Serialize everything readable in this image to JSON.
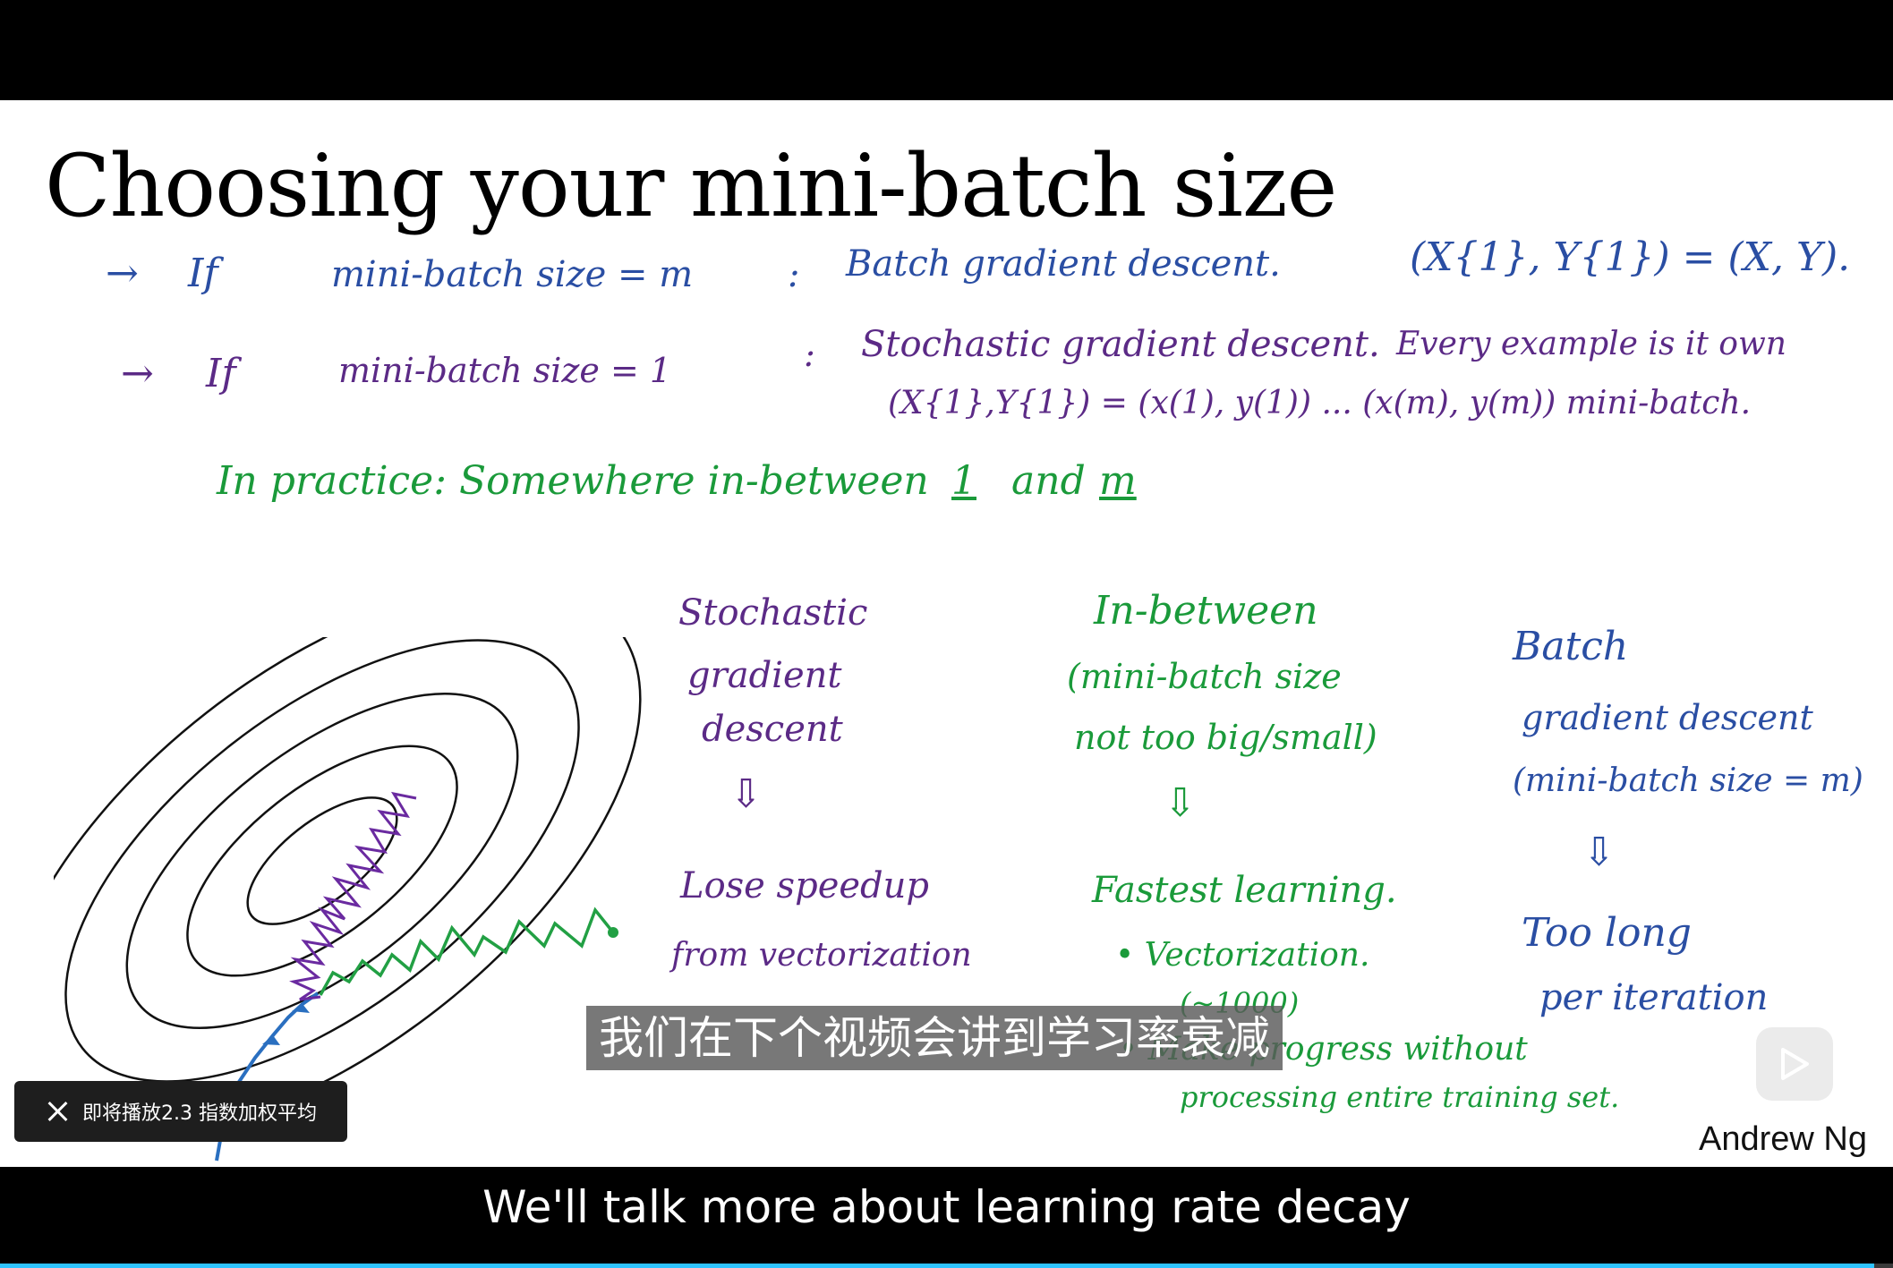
{
  "slide": {
    "title": "Choosing your mini-batch size",
    "line1": {
      "arrow": "→",
      "if": "If",
      "condition": "mini-batch  size = m",
      "colon": ":",
      "result": "Batch  gradient  descent.",
      "formula": "(X{1}, Y{1}) = (X, Y)."
    },
    "line2": {
      "arrow": "→",
      "if": "If",
      "condition": "mini-batch  size = 1",
      "colon": ":",
      "result": "Stochastic  gradient  descent.",
      "note": "Every  example  is  it  own",
      "formula": "(X{1},Y{1}) = (x(1), y(1))  ...  (x(m), y(m))  mini-batch."
    },
    "line3": {
      "prefix": "In  practice:  Somewhere  in-between",
      "one": "1",
      "and": "and",
      "m": "m"
    },
    "stochastic": {
      "title_l1": "Stochastic",
      "title_l2": "gradient",
      "title_l3": "descent",
      "brace": "⇩",
      "result_l1": "Lose  speedup",
      "result_l2": "from  vectorization"
    },
    "inbetween": {
      "title": "In-between",
      "sub_l1": "(mini-batch  size",
      "sub_l2": "not  too  big/small)",
      "brace": "⇩",
      "result": "Fastest  learning.",
      "bullet1": "• Vectorization.",
      "bullet1_sub": "(~1000)",
      "bullet2": "• Make  progress  without",
      "bullet2_sub": "processing  entire  training  set."
    },
    "batch": {
      "title_l1": "Batch",
      "title_l2": "gradient  descent",
      "title_l3": "(mini-batch  size = m)",
      "brace": "⇩",
      "result_l1": "Too  long",
      "result_l2": "per  iteration"
    },
    "author": "Andrew Ng"
  },
  "subtitles": {
    "zh": "我们在下个视频会讲到学习率衰减",
    "en": "We'll talk more about learning rate decay"
  },
  "next_up": {
    "label": "即将播放2.3 指数加权平均"
  },
  "colors": {
    "blue_ink": "#2a4ea3",
    "purple_ink": "#5b2a86",
    "green_ink": "#1a9a3a",
    "progress": "#2ec3ff"
  },
  "icons": [
    "close-icon",
    "play-icon"
  ],
  "progress": 0.99
}
